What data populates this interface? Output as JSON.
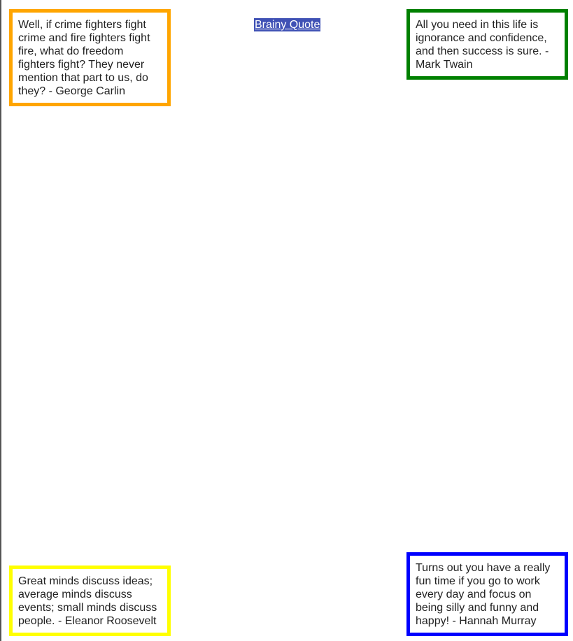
{
  "link": {
    "label": "Brainy Quote"
  },
  "quotes": [
    {
      "text": "Well, if crime fighters fight crime and fire fighters fight fire, what do freedom fighters fight? They never mention that part to us, do they? - George Carlin",
      "border_color": "#FFA500"
    },
    {
      "text": "All you need in this life is ignorance and confidence, and then success is sure. - Mark Twain",
      "border_color": "#008000"
    },
    {
      "text": "Great minds discuss ideas; average minds discuss events; small minds discuss people. - Eleanor Roosevelt",
      "border_color": "#FFFF00"
    },
    {
      "text": "Turns out you have a really fun time if you go to work every day and focus on being silly and funny and happy! - Hannah Murray",
      "border_color": "#0000FF"
    }
  ],
  "colors": {
    "link_background": "#3F51B5",
    "link_text": "#FFFFFF"
  }
}
